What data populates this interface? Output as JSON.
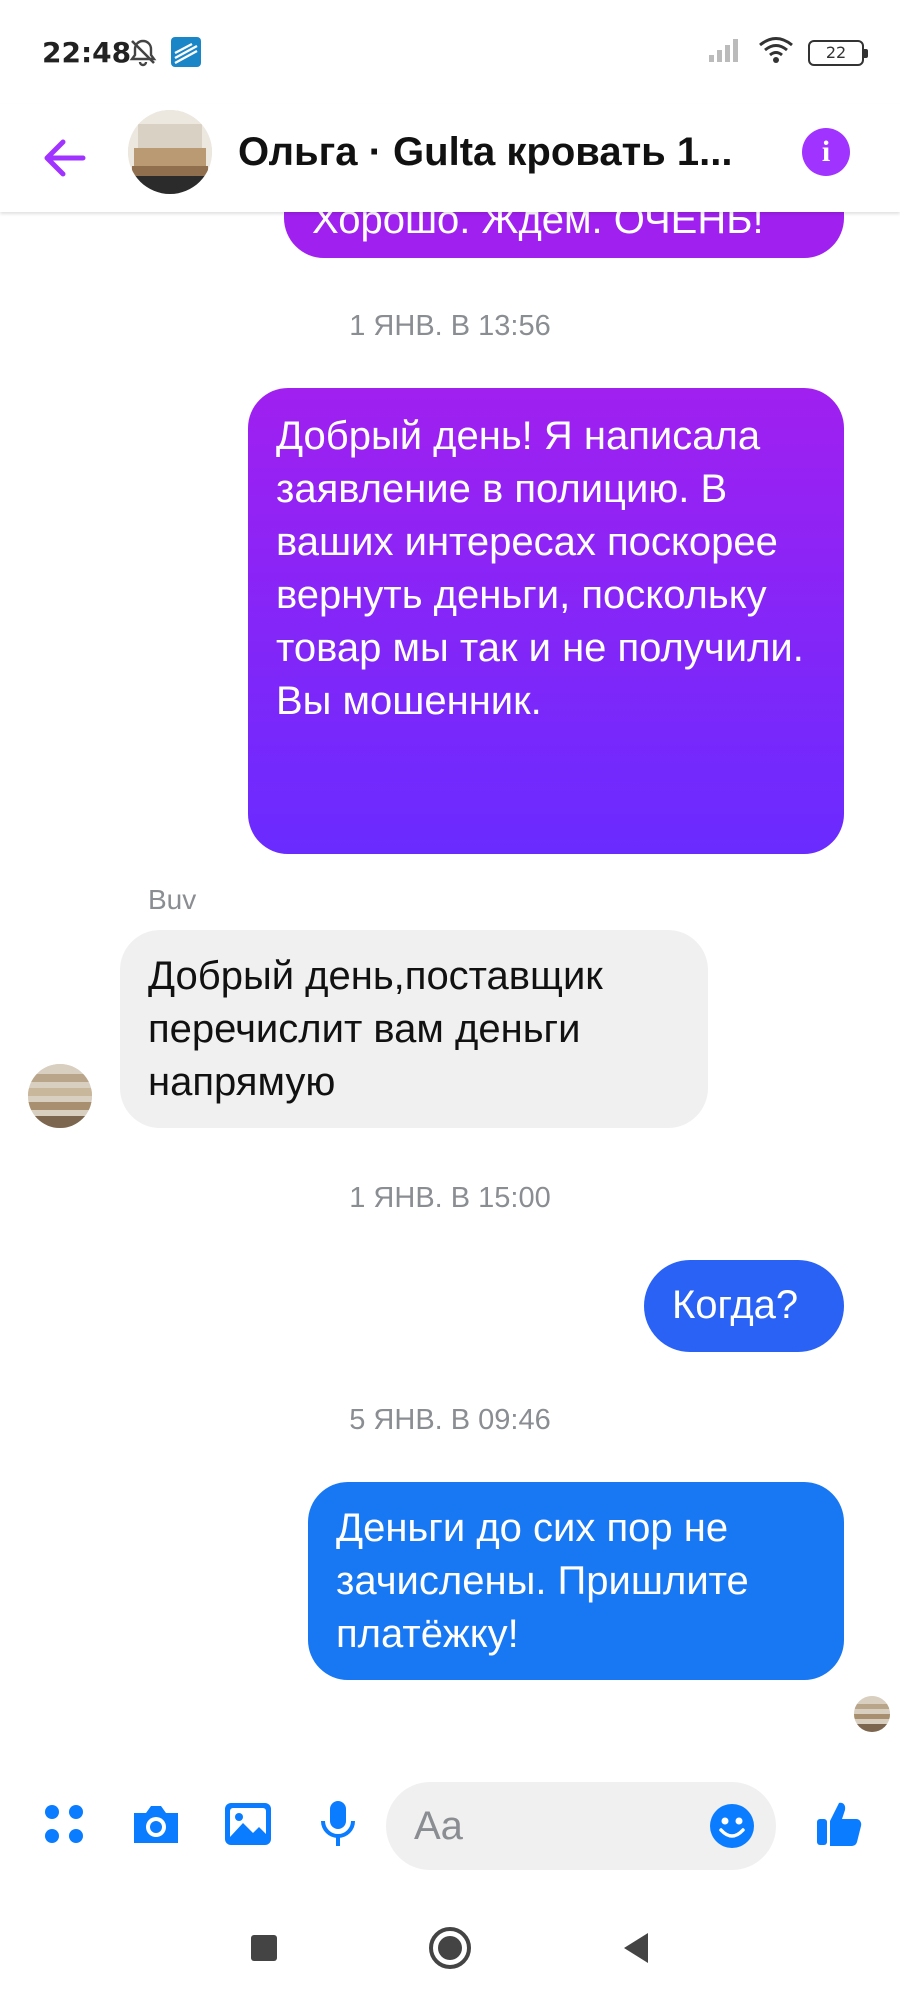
{
  "status_bar": {
    "time": "22:48",
    "battery_level": "22",
    "icons": [
      "mute-icon",
      "app-icon",
      "signal-icon",
      "wifi-icon",
      "battery-icon"
    ]
  },
  "header": {
    "title": "Ольга · Gulta кровать 1...",
    "icons": [
      "back-arrow-icon",
      "info-icon"
    ]
  },
  "colors": {
    "accent": "#a033ff",
    "bubble_purple_top": "#a020f0",
    "bubble_purple_bottom": "#6a2bff",
    "bubble_blue": "#1877f2",
    "incoming_bubble": "#f0f0f0",
    "timestamp": "#8a8d91",
    "composer_icons": "#0a7cff"
  },
  "messages": [
    {
      "type": "outgoing",
      "text": "Хорошо. Ждем. ОЧЕНЬ!",
      "partial": true
    },
    {
      "type": "timestamp",
      "text": "1 ЯНВ. В 13:56"
    },
    {
      "type": "outgoing",
      "text": "Добрый день! Я написала заявление в полицию. В ваших интересах поскорее вернуть деньги, поскольку товар мы так и не получили. Вы мошенник."
    },
    {
      "type": "sender",
      "text": "Buv"
    },
    {
      "type": "incoming",
      "text": "Добрый день,поставщик перечислит вам деньги напрямую"
    },
    {
      "type": "timestamp",
      "text": "1 ЯНВ. В 15:00"
    },
    {
      "type": "outgoing",
      "text": "Когда?"
    },
    {
      "type": "timestamp",
      "text": "5 ЯНВ. В 09:46"
    },
    {
      "type": "outgoing",
      "text": "Деньги до сих пор не зачислены. Пришлите платёжку!"
    }
  ],
  "composer": {
    "placeholder": "Aa",
    "icons": [
      "apps-icon",
      "camera-icon",
      "image-icon",
      "microphone-icon",
      "emoji-icon",
      "thumbs-up-icon"
    ]
  },
  "navbar": {
    "icons": [
      "recents-icon",
      "home-icon",
      "back-icon"
    ]
  }
}
